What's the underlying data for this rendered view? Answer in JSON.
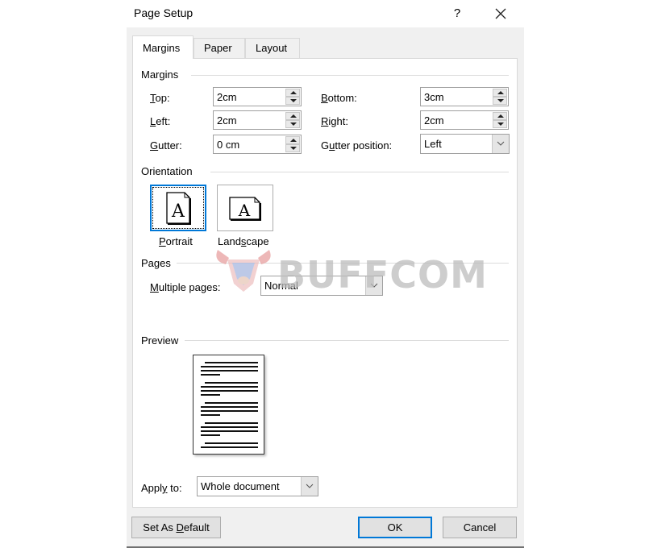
{
  "dialog": {
    "title": "Page Setup",
    "help_label": "?",
    "close_icon": "close-icon"
  },
  "tabs": [
    {
      "label": "Margins",
      "active": true
    },
    {
      "label": "Paper",
      "active": false
    },
    {
      "label": "Layout",
      "active": false
    }
  ],
  "margins": {
    "group_label": "Margins",
    "top": {
      "label_u": "T",
      "label_rest": "op:",
      "value": "2cm"
    },
    "bottom": {
      "label_u": "B",
      "label_rest": "ottom:",
      "value": "3cm"
    },
    "left": {
      "label_u": "L",
      "label_rest": "eft:",
      "value": "2cm"
    },
    "right": {
      "label_u": "R",
      "label_rest": "ight:",
      "value": "2cm"
    },
    "gutter": {
      "label_u": "G",
      "label_rest": "utter:",
      "value": "0 cm"
    },
    "gutter_position": {
      "label_pre": "G",
      "label_u": "u",
      "label_rest": "tter position:",
      "value": "Left"
    }
  },
  "orientation": {
    "group_label": "Orientation",
    "portrait": {
      "label_u": "P",
      "label_rest": "ortrait",
      "glyph": "A",
      "selected": true
    },
    "landscape": {
      "label_pre": "Land",
      "label_u": "s",
      "label_rest": "cape",
      "glyph": "A",
      "selected": false
    }
  },
  "pages": {
    "group_label": "Pages",
    "multiple_pages": {
      "label_u": "M",
      "label_rest": "ultiple pages:",
      "value": "Normal"
    }
  },
  "preview": {
    "group_label": "Preview",
    "apply_to": {
      "label_pre": "Appl",
      "label_u": "y",
      "label_rest": " to:",
      "value": "Whole document"
    }
  },
  "buttons": {
    "set_default": {
      "label_pre": "Set As ",
      "label_u": "D",
      "label_rest": "efault"
    },
    "ok": "OK",
    "cancel": "Cancel"
  },
  "watermark": {
    "text": "BUFFCOM"
  },
  "colors": {
    "accent": "#0078d7",
    "dialog_bg": "#f0f0f0",
    "panel_bg": "#ffffff"
  }
}
